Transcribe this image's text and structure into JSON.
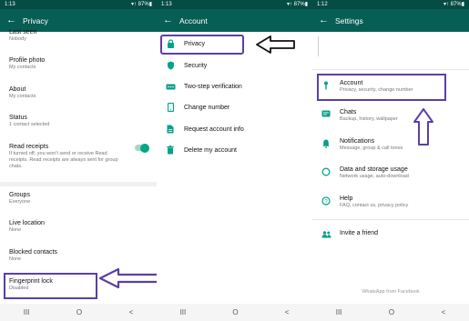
{
  "panel1": {
    "status_time": "1:13",
    "status_right": "▾↑ 87%▮",
    "title": "Privacy",
    "rows": [
      {
        "title": "Last seen",
        "sub": "Nobody"
      },
      {
        "title": "Profile photo",
        "sub": "My contacts"
      },
      {
        "title": "About",
        "sub": "My contacts"
      },
      {
        "title": "Status",
        "sub": "1 contact selected"
      },
      {
        "title": "Read receipts",
        "sub": "If turned off, you won't send or receive Read receipts. Read receipts are always sent for group chats."
      },
      {
        "title": "Groups",
        "sub": "Everyone"
      },
      {
        "title": "Live location",
        "sub": "None"
      },
      {
        "title": "Blocked contacts",
        "sub": "None"
      },
      {
        "title": "Fingerprint lock",
        "sub": "Disabled"
      }
    ],
    "read_receipts_enabled": true
  },
  "panel2": {
    "status_time": "1:13",
    "status_right": "▾↑ 87%▮",
    "title": "Account",
    "items": [
      {
        "label": "Privacy",
        "icon": "lock-icon"
      },
      {
        "label": "Security",
        "icon": "shield-icon"
      },
      {
        "label": "Two-step verification",
        "icon": "dots-icon"
      },
      {
        "label": "Change number",
        "icon": "phone-icon"
      },
      {
        "label": "Request account info",
        "icon": "document-icon"
      },
      {
        "label": "Delete my account",
        "icon": "trash-icon"
      }
    ]
  },
  "panel3": {
    "status_time": "1:12",
    "status_right": "▾↑ 87%▮",
    "title": "Settings",
    "items": [
      {
        "title": "Account",
        "sub": "Privacy, security, change number",
        "icon": "key-icon"
      },
      {
        "title": "Chats",
        "sub": "Backup, history, wallpaper",
        "icon": "chat-icon"
      },
      {
        "title": "Notifications",
        "sub": "Message, group & call tones",
        "icon": "bell-icon"
      },
      {
        "title": "Data and storage usage",
        "sub": "Network usage, auto-download",
        "icon": "data-icon"
      },
      {
        "title": "Help",
        "sub": "FAQ, contact us, privacy policy",
        "icon": "help-icon"
      },
      {
        "title": "Invite a friend",
        "sub": "",
        "icon": "people-icon"
      }
    ],
    "footer": "WhatsApp from Facebook"
  },
  "navbar": {
    "recent": "III",
    "home": "O",
    "back": "<"
  },
  "colors": {
    "header": "#075e54",
    "statusbar": "#054d44",
    "accent": "#01a884",
    "highlight": "#5b3fa8"
  }
}
